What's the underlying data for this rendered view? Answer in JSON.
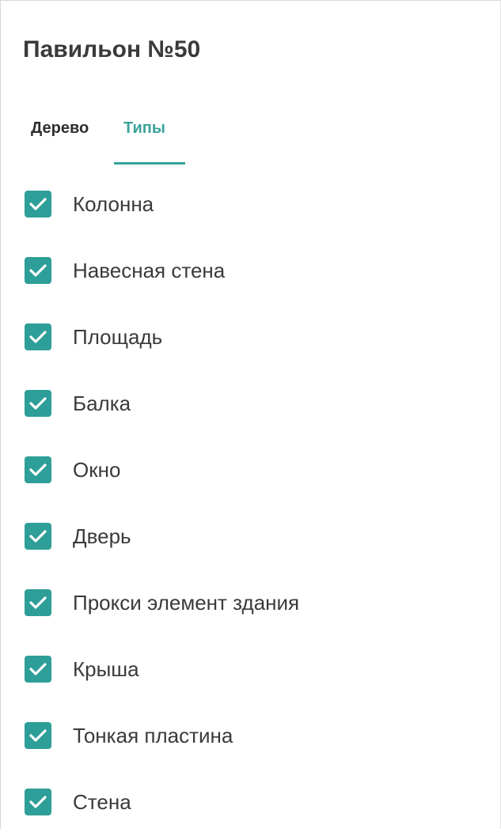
{
  "panel": {
    "title": "Павильон №50"
  },
  "tabs": [
    {
      "label": "Дерево",
      "active": false
    },
    {
      "label": "Типы",
      "active": true
    }
  ],
  "colors": {
    "accent": "#35a29a",
    "checkbox": "#2e9e98",
    "text": "#3a3a3a"
  },
  "types": [
    {
      "label": "Колонна",
      "checked": true
    },
    {
      "label": "Навесная стена",
      "checked": true
    },
    {
      "label": "Площадь",
      "checked": true
    },
    {
      "label": "Балка",
      "checked": true
    },
    {
      "label": "Окно",
      "checked": true
    },
    {
      "label": "Дверь",
      "checked": true
    },
    {
      "label": "Прокси элемент здания",
      "checked": true
    },
    {
      "label": "Крыша",
      "checked": true
    },
    {
      "label": "Тонкая пластина",
      "checked": true
    },
    {
      "label": "Стена",
      "checked": true
    }
  ]
}
